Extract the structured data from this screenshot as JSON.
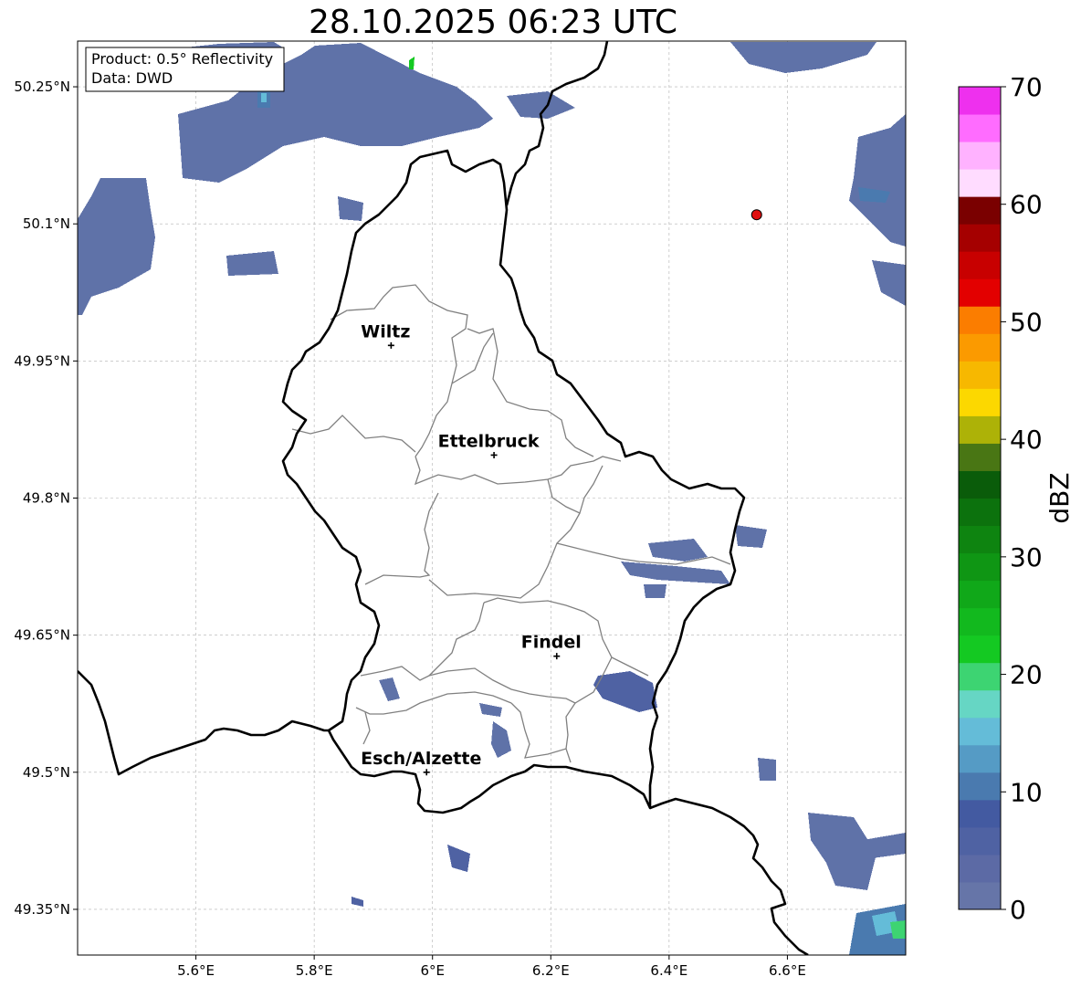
{
  "title": "28.10.2025 06:23 UTC",
  "info": {
    "product": "Product: 0.5° Reflectivity",
    "data_source": "Data: DWD"
  },
  "map": {
    "lon_range": [
      5.4,
      6.8
    ],
    "lat_range": [
      49.3,
      50.3
    ],
    "lon_ticks": [
      {
        "value": 5.6,
        "label": "5.6°E"
      },
      {
        "value": 5.8,
        "label": "5.8°E"
      },
      {
        "value": 6.0,
        "label": "6°E"
      },
      {
        "value": 6.2,
        "label": "6.2°E"
      },
      {
        "value": 6.4,
        "label": "6.4°E"
      },
      {
        "value": 6.6,
        "label": "6.6°E"
      }
    ],
    "lat_ticks": [
      {
        "value": 49.35,
        "label": "49.35°N"
      },
      {
        "value": 49.5,
        "label": "49.5°N"
      },
      {
        "value": 49.65,
        "label": "49.65°N"
      },
      {
        "value": 49.8,
        "label": "49.8°N"
      },
      {
        "value": 49.95,
        "label": "49.95°N"
      },
      {
        "value": 50.1,
        "label": "50.1°N"
      },
      {
        "value": 50.25,
        "label": "50.25°N"
      }
    ],
    "cities": [
      {
        "name": "Wiltz",
        "lon": 5.93,
        "lat": 49.967
      },
      {
        "name": "Ettelbruck",
        "lon": 6.104,
        "lat": 49.847
      },
      {
        "name": "Findel",
        "lon": 6.21,
        "lat": 49.627
      },
      {
        "name": "Esch/Alzette",
        "lon": 5.99,
        "lat": 49.5
      }
    ],
    "radar_site": {
      "lon": 6.548,
      "lat": 50.11,
      "color": "#e01010"
    }
  },
  "colorbar": {
    "label": "dBZ",
    "min": 0,
    "max": 70,
    "step": 2.5,
    "ticks": [
      {
        "value": 0,
        "label": "0"
      },
      {
        "value": 10,
        "label": "10"
      },
      {
        "value": 20,
        "label": "20"
      },
      {
        "value": 30,
        "label": "30"
      },
      {
        "value": 40,
        "label": "40"
      },
      {
        "value": 50,
        "label": "50"
      },
      {
        "value": 60,
        "label": "60"
      },
      {
        "value": 70,
        "label": "70"
      }
    ],
    "colors": [
      "#6675a8",
      "#5c6aa5",
      "#4f62a3",
      "#435aa1",
      "#4a7aaf",
      "#559bc5",
      "#64bcd8",
      "#66d6c4",
      "#3dd472",
      "#14c922",
      "#12b91e",
      "#10a819",
      "#0f9614",
      "#0e8410",
      "#0c720d",
      "#0a5c0a",
      "#497614",
      "#adb207",
      "#fcd800",
      "#f7b800",
      "#fb9a00",
      "#fb7d00",
      "#e30000",
      "#c80000",
      "#a50000",
      "#7a0000",
      "#ffdcff",
      "#ffb2ff",
      "#ff6cff",
      "#ee30ee"
    ]
  }
}
